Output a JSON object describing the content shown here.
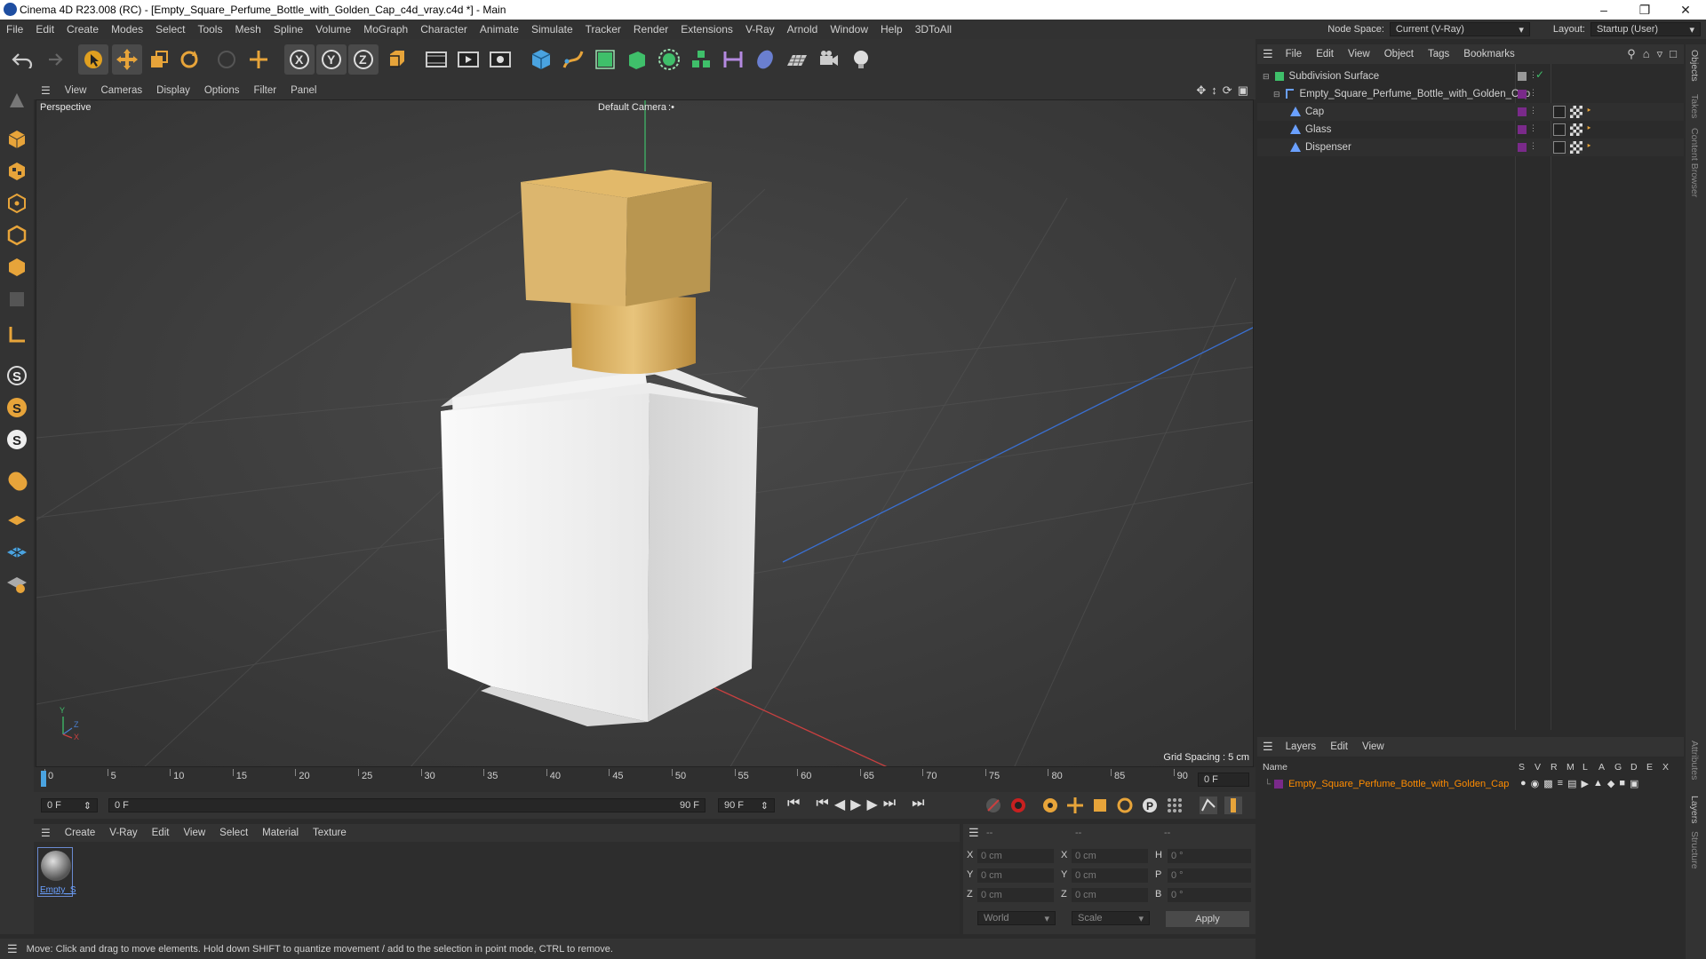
{
  "window": {
    "title": "Cinema 4D R23.008 (RC) - [Empty_Square_Perfume_Bottle_with_Golden_Cap_c4d_vray.c4d *] - Main"
  },
  "menubar": {
    "items": [
      "File",
      "Edit",
      "Create",
      "Modes",
      "Select",
      "Tools",
      "Mesh",
      "Spline",
      "Volume",
      "MoGraph",
      "Character",
      "Animate",
      "Simulate",
      "Tracker",
      "Render",
      "Extensions",
      "V-Ray",
      "Arnold",
      "Window",
      "Help",
      "3DToAll"
    ],
    "node_space_label": "Node Space:",
    "node_space_value": "Current (V-Ray)",
    "layout_label": "Layout:",
    "layout_value": "Startup (User)"
  },
  "viewport": {
    "menu": [
      "View",
      "Cameras",
      "Display",
      "Options",
      "Filter",
      "Panel"
    ],
    "view_name": "Perspective",
    "camera": "Default Camera",
    "grid_spacing": "Grid Spacing : 5 cm",
    "axis_y": "Y",
    "axis_z": "Z",
    "axis_x": "X"
  },
  "timeline": {
    "ticks": [
      "0",
      "5",
      "10",
      "15",
      "20",
      "25",
      "30",
      "35",
      "40",
      "45",
      "50",
      "55",
      "60",
      "65",
      "70",
      "75",
      "80",
      "85",
      "90"
    ],
    "current_frame_field": "0 F",
    "start_field": "0 F",
    "range_start": "0 F",
    "range_end": "90 F",
    "end_field": "90 F"
  },
  "material_manager": {
    "menu": [
      "Create",
      "V-Ray",
      "Edit",
      "View",
      "Select",
      "Material",
      "Texture"
    ],
    "material_name": "Empty_S"
  },
  "coordinates": {
    "header": [
      "--",
      "--",
      "--"
    ],
    "rows": [
      {
        "l1": "X",
        "v1": "0 cm",
        "l2": "X",
        "v2": "0 cm",
        "l3": "H",
        "v3": "0 °"
      },
      {
        "l1": "Y",
        "v1": "0 cm",
        "l2": "Y",
        "v2": "0 cm",
        "l3": "P",
        "v3": "0 °"
      },
      {
        "l1": "Z",
        "v1": "0 cm",
        "l2": "Z",
        "v2": "0 cm",
        "l3": "B",
        "v3": "0 °"
      }
    ],
    "world_dropdown": "World",
    "scale_dropdown": "Scale",
    "apply_label": "Apply"
  },
  "status_bar": {
    "text": "Move: Click and drag to move elements. Hold down SHIFT to quantize movement / add to the selection in point mode, CTRL to remove."
  },
  "object_manager": {
    "menu": [
      "File",
      "Edit",
      "View",
      "Object",
      "Tags",
      "Bookmarks"
    ],
    "objects": [
      {
        "name": "Subdivision Surface"
      },
      {
        "name": "Empty_Square_Perfume_Bottle_with_Golden_Cap"
      },
      {
        "name": "Cap"
      },
      {
        "name": "Glass"
      },
      {
        "name": "Dispenser"
      }
    ]
  },
  "layer_manager": {
    "menu": [
      "Layers",
      "Edit",
      "View"
    ],
    "header_name": "Name",
    "columns": [
      "S",
      "V",
      "R",
      "M",
      "L",
      "A",
      "G",
      "D",
      "E",
      "X"
    ],
    "layer_name": "Empty_Square_Perfume_Bottle_with_Golden_Cap",
    "layer_color": "#ff8c00"
  },
  "side_tabs": [
    "Objects",
    "Takes",
    "Content Browser",
    "Attributes",
    "Layers",
    "Structure"
  ],
  "colors": {
    "accent_orange": "#ff8c00",
    "cap_gold": "#d9b46a",
    "bottle_white": "#efefef",
    "layer_purple": "#7a2a8a"
  }
}
